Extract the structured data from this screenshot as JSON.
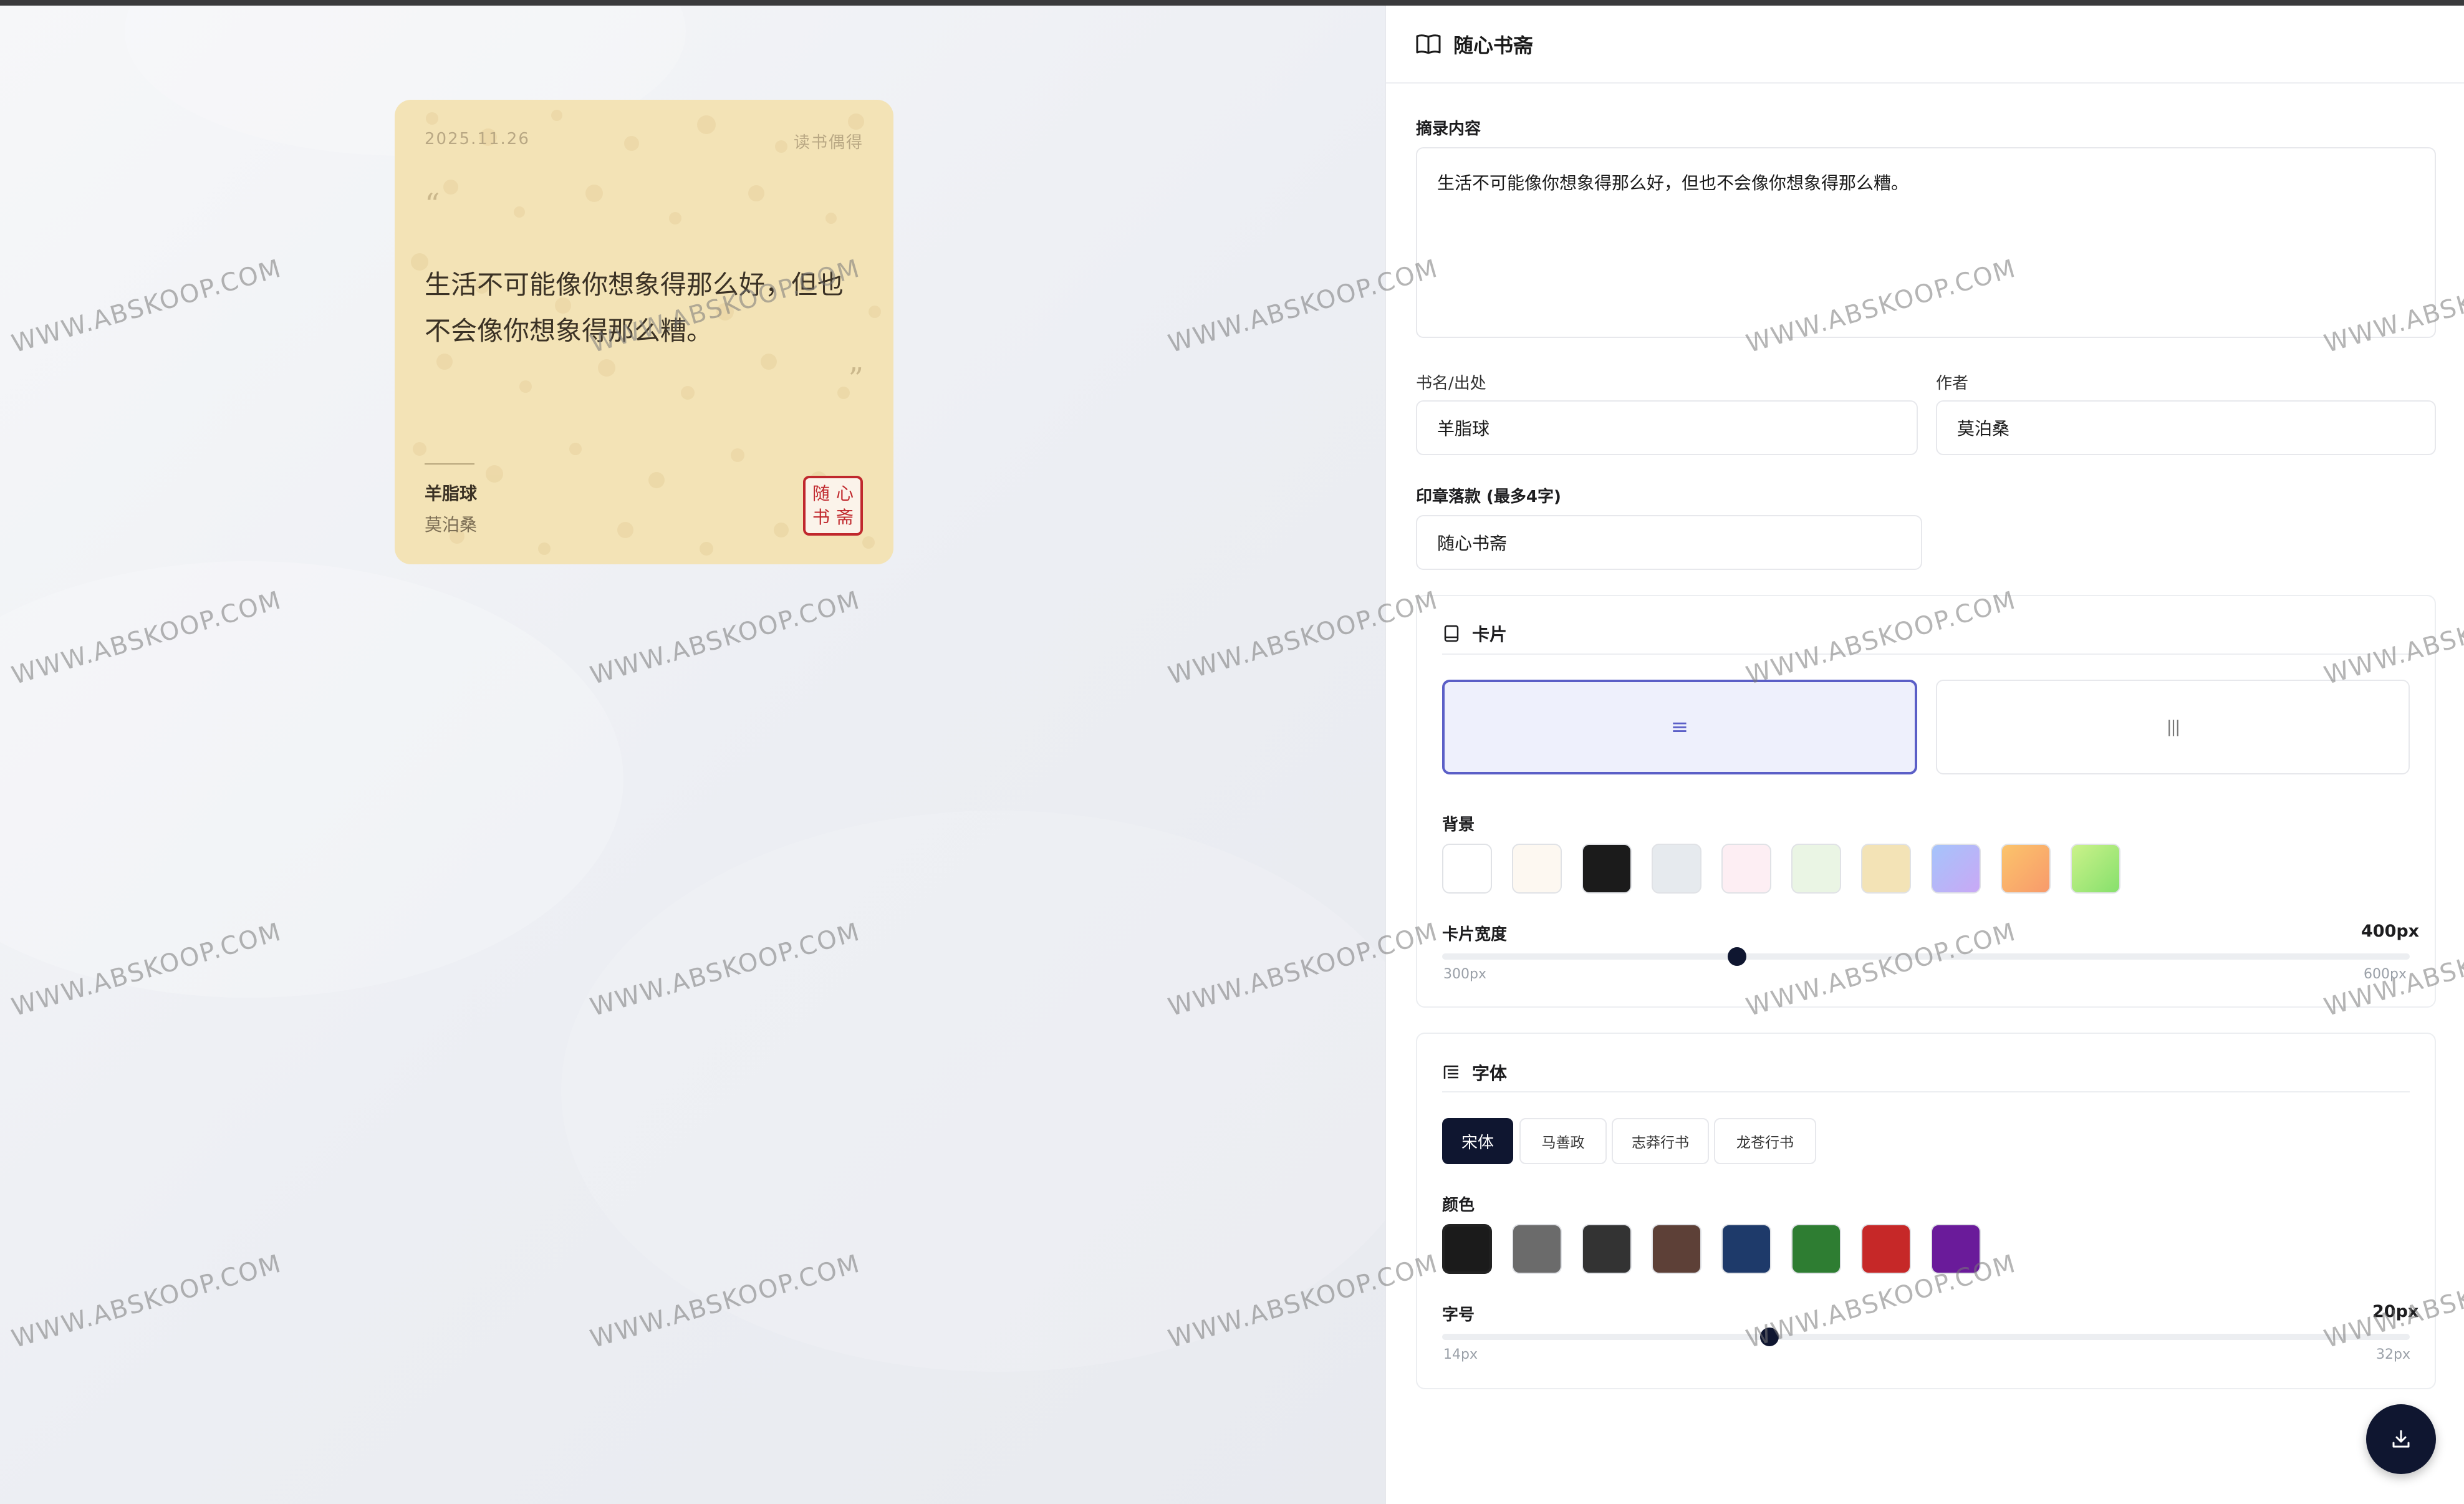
{
  "app": {
    "title": "随心书斋"
  },
  "card": {
    "date": "2025.11.26",
    "tag": "读书偶得",
    "open_quote": "“",
    "close_quote": "”",
    "text": "生活不可能像你想象得那么好，但也不会像你想象得那么糟。",
    "book": "羊脂球",
    "author": "莫泊桑",
    "seal_chars": [
      "随",
      "心",
      "书",
      "斋"
    ],
    "background_color": "#f3e3b6"
  },
  "form": {
    "excerpt_label": "摘录内容",
    "excerpt_value": "生活不可能像你想象得那么好，但也不会像你想象得那么糟。",
    "book_label": "书名/出处",
    "book_value": "羊脂球",
    "author_label": "作者",
    "author_value": "莫泊桑",
    "seal_label": "印章落款 (最多4字)",
    "seal_value": "随心书斋"
  },
  "card_section": {
    "title": "卡片",
    "layouts": [
      {
        "icon": "≡",
        "name": "horizontal",
        "active": true
      },
      {
        "icon": "|||",
        "name": "vertical",
        "active": false
      }
    ],
    "background_label": "背景",
    "backgrounds": [
      "#ffffff",
      "#fdf8f1",
      "#1b1b1b",
      "#e6eaee",
      "#fdeef3",
      "#eaf5e4",
      "#f3e3b6",
      "gradient-blue-purple",
      "gradient-orange",
      "gradient-green"
    ],
    "selected_background_index": 6,
    "width_label": "卡片宽度",
    "width_value": "400px",
    "width_min": "300px",
    "width_max": "600px",
    "width_current": 400
  },
  "font_section": {
    "title": "字体",
    "fonts": [
      "宋体",
      "马善政",
      "志莽行书",
      "龙苍行书"
    ],
    "selected_font_index": 0,
    "color_label": "颜色",
    "colors": [
      "#1b1b1b",
      "#6b6b6b",
      "#333333",
      "#5d4037",
      "#1e3a6a",
      "#2e7d32",
      "#c62828",
      "#6a1b9a"
    ],
    "selected_color_index": 0,
    "size_label": "字号",
    "size_value": "20px",
    "size_min": "14px",
    "size_max": "32px",
    "size_current": 20
  },
  "download": {
    "icon": "download-icon"
  },
  "watermark": "WWW.ABSKOOP.COM"
}
